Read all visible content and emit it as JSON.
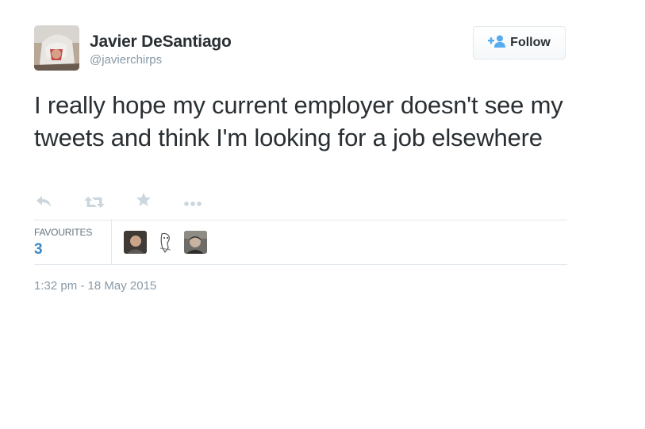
{
  "author": {
    "name": "Javier DeSantiago",
    "handle": "@javierchirps",
    "avatar_icon": "user-avatar-photo"
  },
  "follow_button": {
    "label": "Follow",
    "icon": "add-user-icon",
    "accent": "#55acee"
  },
  "tweet": {
    "text": "I really hope my current employer doesn't see my tweets and think I'm looking for a job elsewhere"
  },
  "actions": [
    {
      "name": "reply",
      "icon": "reply-icon"
    },
    {
      "name": "retweet",
      "icon": "retweet-icon"
    },
    {
      "name": "favourite",
      "icon": "star-icon"
    },
    {
      "name": "more",
      "icon": "more-dots-icon"
    }
  ],
  "stats": {
    "favourites_label": "FAVOURITES",
    "favourites_count": "3",
    "count_color": "#3b88c3"
  },
  "timestamp": "1:32 pm - 18 May 2015"
}
